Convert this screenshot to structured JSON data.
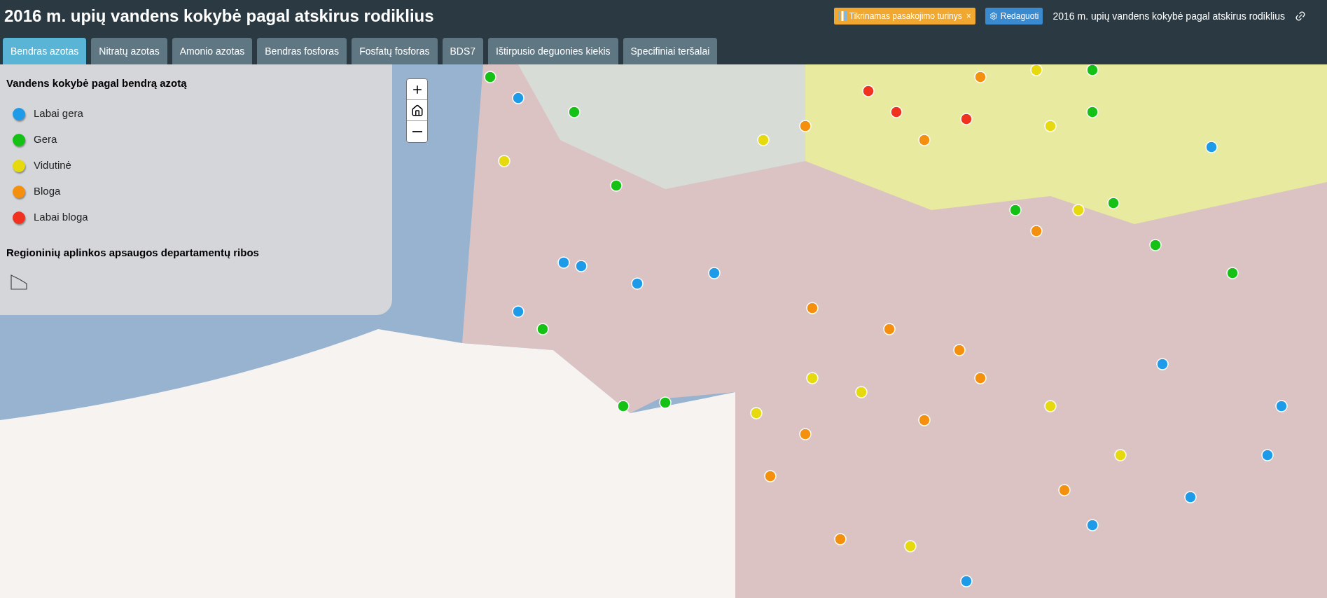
{
  "header": {
    "title": "2016 m. upių vandens kokybė pagal atskirus rodiklius",
    "status_badge": {
      "label": "Tikrinamas pasakojimo turinys",
      "close": "×"
    },
    "edit_button": "Redaguoti",
    "story_title": "2016 m. upių vandens kokybė pagal atskirus rodiklius"
  },
  "tabs": [
    {
      "label": "Bendras azotas",
      "selected": true
    },
    {
      "label": "Nitratų azotas",
      "selected": false
    },
    {
      "label": "Amonio azotas",
      "selected": false
    },
    {
      "label": "Bendras fosforas",
      "selected": false
    },
    {
      "label": "Fosfatų fosforas",
      "selected": false
    },
    {
      "label": "BDS7",
      "selected": false
    },
    {
      "label": "Ištirpusio deguonies kiekis",
      "selected": false
    },
    {
      "label": "Specifiniai teršalai",
      "selected": false
    }
  ],
  "legend": {
    "title": "Vandens kokybė pagal bendrą azotą",
    "items": [
      {
        "label": "Labai gera",
        "color": "#1e9be8"
      },
      {
        "label": "Gera",
        "color": "#16c116"
      },
      {
        "label": "Vidutinė",
        "color": "#e6d90e"
      },
      {
        "label": "Bloga",
        "color": "#f5900f"
      },
      {
        "label": "Labai bloga",
        "color": "#f0321e"
      }
    ],
    "boundaries_title": "Regioninių aplinkos apsaugos departamentų ribos"
  }
}
